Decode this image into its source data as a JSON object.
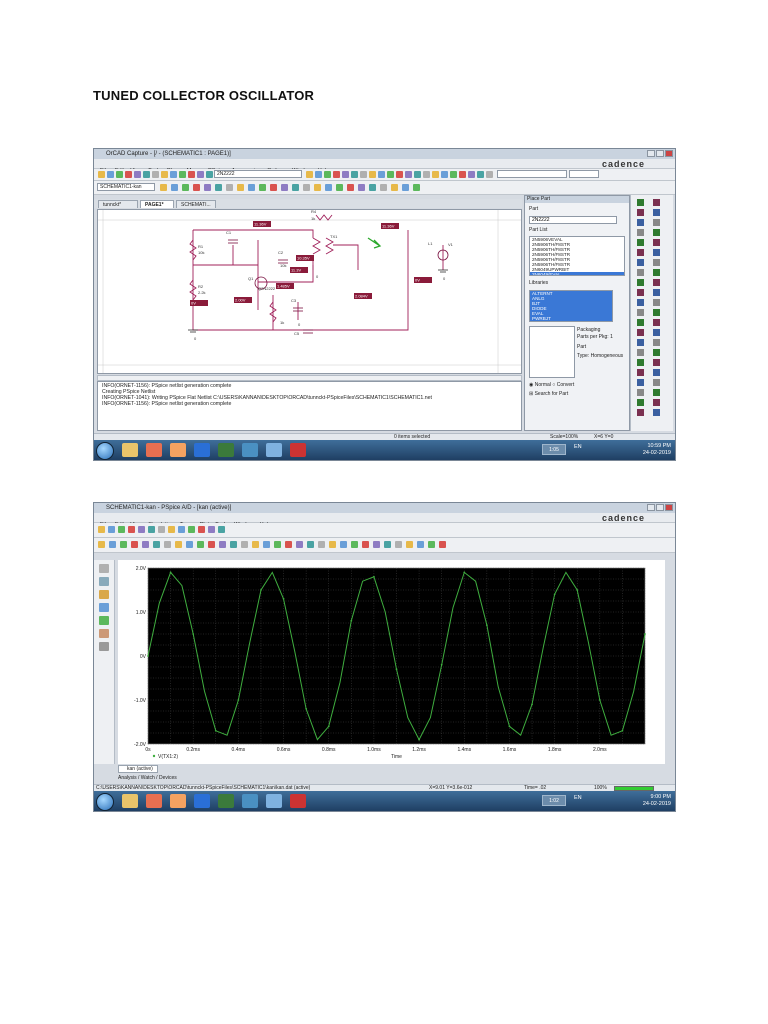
{
  "document": {
    "title": "TUNED COLLECTOR OSCILLATOR"
  },
  "capture": {
    "window_title": "OrCAD Capture - [/ - (SCHEMATIC1 : PAGE1)]",
    "menu": [
      "File",
      "Edit",
      "View",
      "Tools",
      "Place",
      "Macro",
      "PSpice",
      "Accessories",
      "Options",
      "Window",
      "Help"
    ],
    "brand": "cadence",
    "part_combo": "2N2222",
    "profile_combo": "SCHEMATIC1-kan",
    "tabs": [
      "tunnckt*",
      "PAGE1*",
      "SCHEMATI..."
    ],
    "schematic": {
      "labels": [
        "R1",
        "10k",
        "R2",
        "2.2k",
        "C1",
        "Q1",
        "Q2N2222",
        "C2",
        "10k",
        "C3",
        "R4",
        "1k",
        "C5",
        "TX1",
        "V1",
        "L1",
        "1k",
        "0",
        "0",
        "0",
        "0"
      ],
      "probes": [
        "11.36V",
        "11.36V",
        "10.35V",
        "0V",
        "0V",
        "1.485V",
        "2.00V",
        "11.3V",
        "2.084V"
      ]
    },
    "session_log": [
      "INFO(ORNET-1156): PSpice netlist generation complete",
      "Creating PSpice Netlist",
      "INFO(ORNET-1041): Writing PSpice Flat Netlist C:\\USERS\\KANNAN\\DESKTOP\\ORCAD\\tunnckt-PSpiceFiles\\SCHEMATIC1\\SCHEMATIC1.net",
      "INFO(ORNET-1156): PSpice netlist generation complete"
    ],
    "place_part": {
      "title": "Place Part",
      "part_label": "Part",
      "part_value": "2N2222",
      "part_list_label": "Part List",
      "part_list": [
        "2N5906VEVAL",
        "2N5906TH/F8STR",
        "2N5906TH/F8STR",
        "2N5906TH/F8STR",
        "2N5906TH/F8STR",
        "2N5906TH/F8STR",
        "2N6049UPWRBIT",
        "2N6049/EVAL"
      ],
      "libraries_label": "Libraries",
      "libraries": [
        "ALTERNT",
        "ANLG",
        "BJT",
        "DIODE",
        "EVAL",
        "PWRBJT"
      ],
      "packaging_label": "Packaging",
      "parts_per_pkg": "Parts per Pkg:",
      "parts_per_pkg_value": "1",
      "part_field": "Part",
      "type_label": "Type:",
      "type_value": "Homogeneous",
      "normal": "Normal",
      "convert": "Convert",
      "search": "Search for Part"
    },
    "status": {
      "selection": "0 items selected",
      "scale": "Scale=100%",
      "coords": "X=6  Y=0"
    },
    "taskbar": {
      "lang": "EN",
      "time": "10:59 PM",
      "date": "24-02-2019",
      "card": "1:05"
    }
  },
  "capture2": {
    "window_title": "SCHEMATIC1-kan - PSpice A/D - [kan (active)]",
    "menu": [
      "File",
      "Edit",
      "View",
      "Simulation",
      "Trace",
      "Plot",
      "Tools",
      "Window",
      "Help"
    ],
    "brand": "cadence",
    "window_tab": "kan (active)",
    "bottom_tabs": [
      "Analysis",
      "Watch",
      "Devices"
    ],
    "status_path": "C:\\USERS\\KANNAN\\DESKTOP\\ORCAD\\tunnckt-PSpiceFiles\\SCHEMATIC1\\kan\\kan.dat (active)",
    "status_xy": "X=9.01  Y=3.6e-012",
    "status_time": "Time= .02",
    "status_pct": "100%",
    "taskbar": {
      "lang": "EN",
      "time": "9:00 PM",
      "date": "24-02-2019",
      "card": "1:02"
    }
  },
  "chart_data": {
    "type": "line",
    "title": "",
    "xlabel": "Time",
    "ylabel": "",
    "xlim": [
      0,
      2.2
    ],
    "ylim": [
      -2,
      2
    ],
    "x_ticks": [
      "0s",
      "0.2ms",
      "0.4ms",
      "0.6ms",
      "0.8ms",
      "1.0ms",
      "1.2ms",
      "1.4ms",
      "1.6ms",
      "1.8ms",
      "2.0ms"
    ],
    "x_tick_values": [
      0,
      0.2,
      0.4,
      0.6,
      0.8,
      1.0,
      1.2,
      1.4,
      1.6,
      1.8,
      2.0
    ],
    "y_ticks": [
      "2.0V",
      "1.0V",
      "0V",
      "-1.0V",
      "-2.0V"
    ],
    "y_tick_values": [
      2,
      1,
      0,
      -1,
      -2
    ],
    "grid": true,
    "legend": "bottom-left",
    "series": [
      {
        "name": "V(TX1:2)",
        "color": "#3fae3f",
        "x": [
          0,
          0.05,
          0.1,
          0.15,
          0.2,
          0.25,
          0.3,
          0.35,
          0.4,
          0.45,
          0.5,
          0.55,
          0.6,
          0.65,
          0.7,
          0.75,
          0.8,
          0.85,
          0.9,
          0.95,
          1.0,
          1.05,
          1.1,
          1.15,
          1.2,
          1.25,
          1.3,
          1.35,
          1.4,
          1.45,
          1.5,
          1.55,
          1.6,
          1.65,
          1.7,
          1.75,
          1.8,
          1.85,
          1.9,
          1.95,
          2.0,
          2.05,
          2.1,
          2.15,
          2.2
        ],
        "y": [
          0,
          1.2,
          1.9,
          1.6,
          0.5,
          -0.8,
          -1.7,
          -1.8,
          -1.0,
          0.3,
          1.5,
          1.9,
          1.3,
          0.1,
          -1.2,
          -1.9,
          -1.6,
          -0.6,
          0.8,
          1.7,
          1.8,
          1.0,
          -0.3,
          -1.4,
          -1.9,
          -1.4,
          -0.2,
          1.1,
          1.9,
          1.7,
          0.7,
          -0.7,
          -1.6,
          -1.8,
          -1.1,
          0.2,
          1.4,
          1.9,
          1.5,
          0.3,
          -1.0,
          -1.8,
          -1.7,
          -0.8,
          0.5
        ]
      }
    ]
  }
}
